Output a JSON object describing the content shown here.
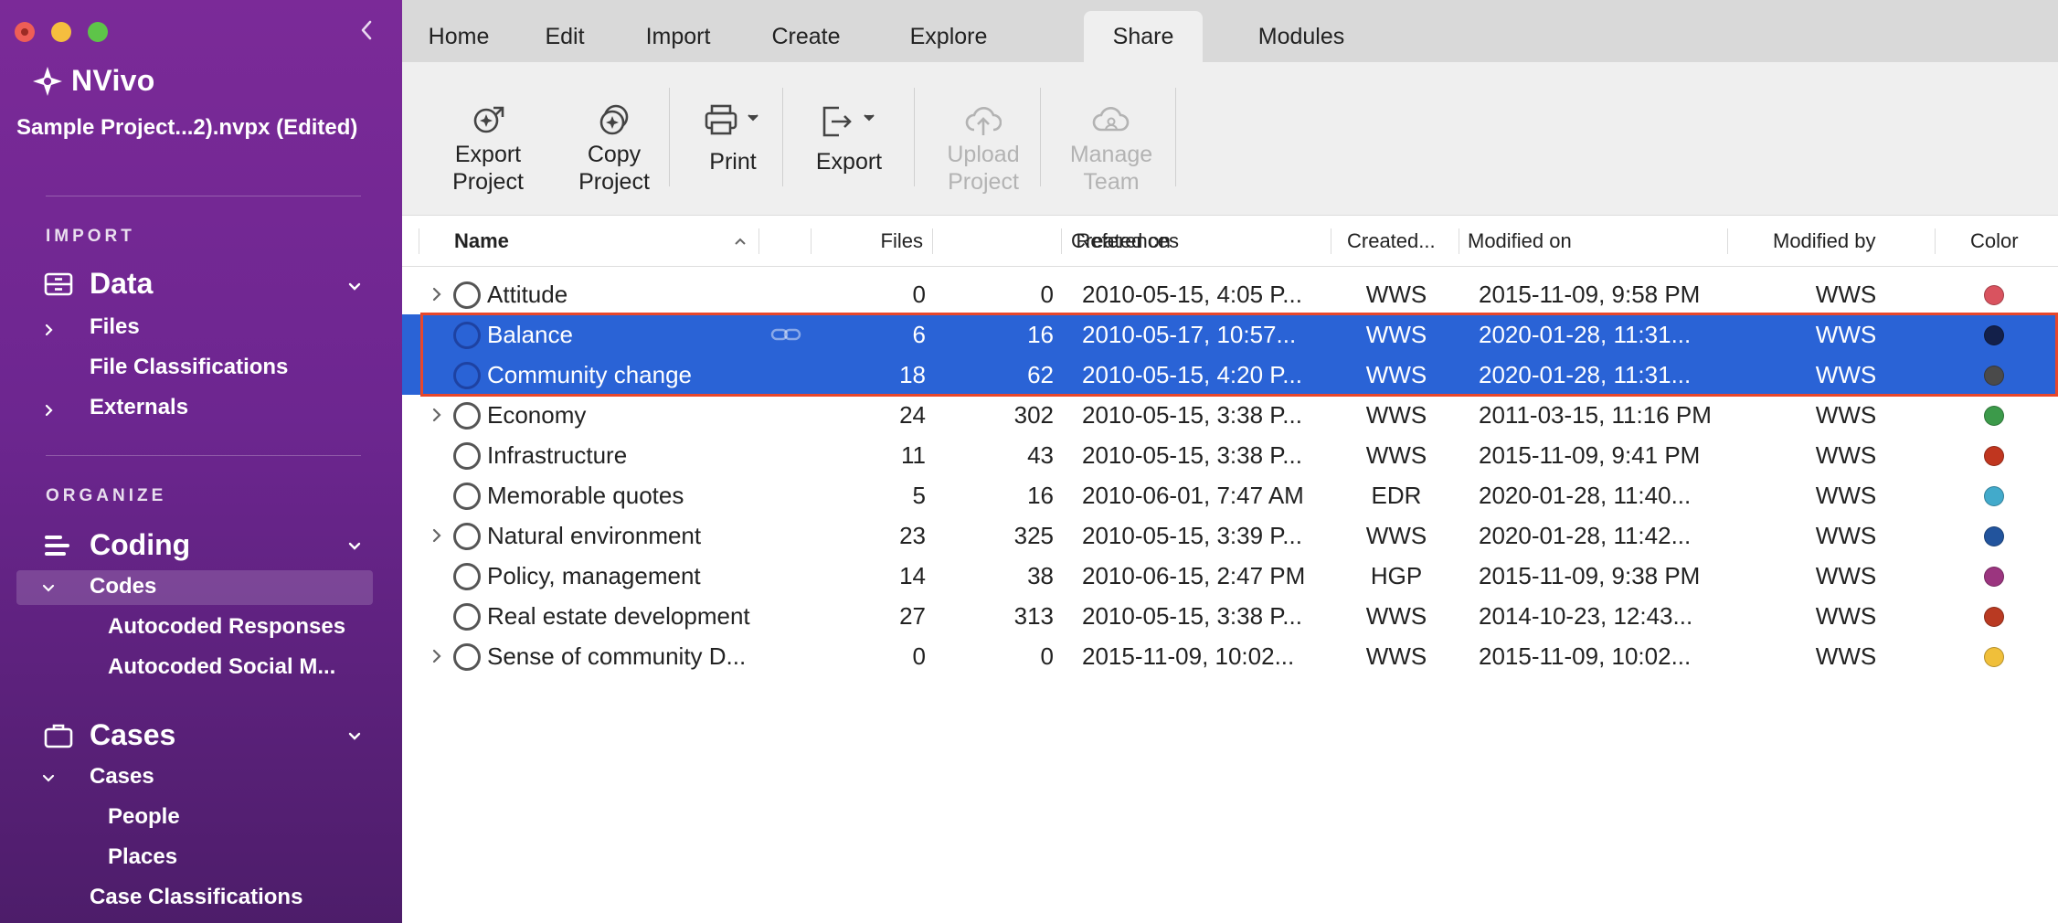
{
  "app": {
    "name": "NVivo",
    "project_title": "Sample Project...2).nvpx (Edited)"
  },
  "sidebar": {
    "import_label": "IMPORT",
    "organize_label": "ORGANIZE",
    "data": {
      "label": "Data",
      "items": [
        "Files",
        "File Classifications",
        "Externals"
      ]
    },
    "coding": {
      "label": "Coding",
      "codes_label": "Codes",
      "sub_items": [
        "Autocoded Responses",
        "Autocoded Social M..."
      ]
    },
    "cases": {
      "label": "Cases",
      "cases_label": "Cases",
      "sub_items": [
        "People",
        "Places"
      ],
      "classifications_label": "Case Classifications"
    }
  },
  "ribbon": {
    "tabs": [
      "Home",
      "Edit",
      "Import",
      "Create",
      "Explore",
      "Share",
      "Modules"
    ],
    "active_tab": "Share",
    "tools": {
      "export_project": [
        "Export",
        "Project"
      ],
      "copy_project": [
        "Copy",
        "Project"
      ],
      "print": "Print",
      "export": "Export",
      "upload_project": [
        "Upload",
        "Project"
      ],
      "manage_team": [
        "Manage",
        "Team"
      ]
    }
  },
  "table": {
    "columns": {
      "name": "Name",
      "files": "Files",
      "references": "References",
      "created_on": "Created on",
      "created_by": "Created...",
      "modified_on": "Modified on",
      "modified_by": "Modified by",
      "color": "Color"
    },
    "rows": [
      {
        "name": "Attitude",
        "expandable": true,
        "files": "0",
        "references": "0",
        "created_on": "2010-05-15, 4:05 P...",
        "created_by": "WWS",
        "modified_on": "2015-11-09, 9:58 PM",
        "modified_by": "WWS",
        "color": "#d9535f",
        "selected": false
      },
      {
        "name": "Balance",
        "expandable": false,
        "files": "6",
        "references": "16",
        "created_on": "2010-05-17, 10:57...",
        "created_by": "WWS",
        "modified_on": "2020-01-28, 11:31...",
        "modified_by": "WWS",
        "color": "#13204a",
        "selected": true,
        "linked": true
      },
      {
        "name": "Community change",
        "expandable": false,
        "files": "18",
        "references": "62",
        "created_on": "2010-05-15, 4:20 P...",
        "created_by": "WWS",
        "modified_on": "2020-01-28, 11:31...",
        "modified_by": "WWS",
        "color": "#4a4a4a",
        "selected": true
      },
      {
        "name": "Economy",
        "expandable": true,
        "files": "24",
        "references": "302",
        "created_on": "2010-05-15, 3:38 P...",
        "created_by": "WWS",
        "modified_on": "2011-03-15, 11:16 PM",
        "modified_by": "WWS",
        "color": "#3c9a4a",
        "selected": false
      },
      {
        "name": "Infrastructure",
        "expandable": false,
        "files": "11",
        "references": "43",
        "created_on": "2010-05-15, 3:38 P...",
        "created_by": "WWS",
        "modified_on": "2015-11-09, 9:41 PM",
        "modified_by": "WWS",
        "color": "#c0361f",
        "selected": false
      },
      {
        "name": "Memorable quotes",
        "expandable": false,
        "files": "5",
        "references": "16",
        "created_on": "2010-06-01, 7:47 AM",
        "created_by": "EDR",
        "modified_on": "2020-01-28, 11:40...",
        "modified_by": "WWS",
        "color": "#42aacb",
        "selected": false
      },
      {
        "name": "Natural environment",
        "expandable": true,
        "files": "23",
        "references": "325",
        "created_on": "2010-05-15, 3:39 P...",
        "created_by": "WWS",
        "modified_on": "2020-01-28, 11:42...",
        "modified_by": "WWS",
        "color": "#22549d",
        "selected": false
      },
      {
        "name": "Policy, management",
        "expandable": false,
        "files": "14",
        "references": "38",
        "created_on": "2010-06-15, 2:47 PM",
        "created_by": "HGP",
        "modified_on": "2015-11-09, 9:38 PM",
        "modified_by": "WWS",
        "color": "#9b357f",
        "selected": false
      },
      {
        "name": "Real estate development",
        "expandable": false,
        "files": "27",
        "references": "313",
        "created_on": "2010-05-15, 3:38 P...",
        "created_by": "WWS",
        "modified_on": "2014-10-23, 12:43...",
        "modified_by": "WWS",
        "color": "#b93a22",
        "selected": false
      },
      {
        "name": "Sense of community D...",
        "expandable": true,
        "files": "0",
        "references": "0",
        "created_on": "2015-11-09, 10:02...",
        "created_by": "WWS",
        "modified_on": "2015-11-09, 10:02...",
        "modified_by": "WWS",
        "color": "#f0bf3a",
        "selected": false
      }
    ]
  },
  "colors": {
    "sidebar": "#7b2a98",
    "selection": "#2a63d6",
    "highlight_outline": "#e8472b"
  }
}
